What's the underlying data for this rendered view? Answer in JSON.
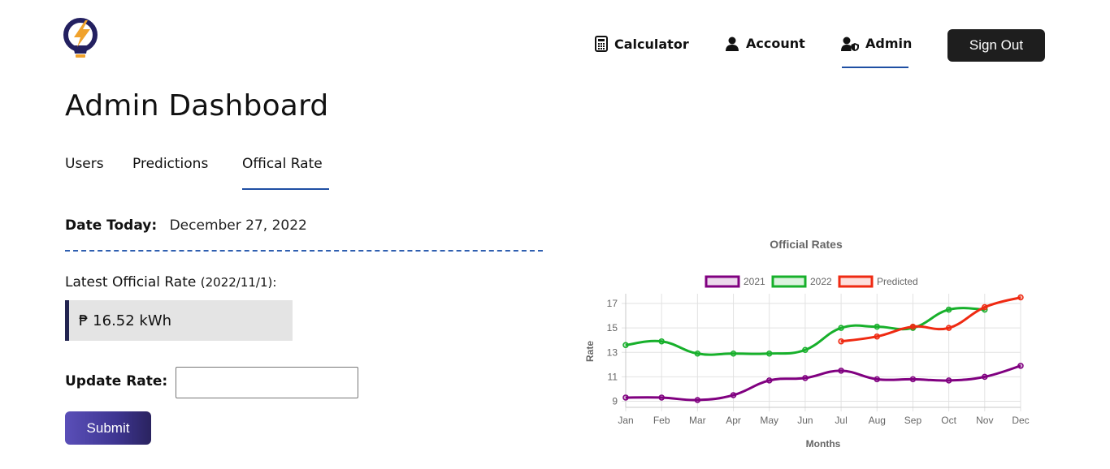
{
  "brand": {
    "logo_icon": "lightbulb-bolt-icon",
    "colors": {
      "bulb": "#232060",
      "bolt": "#f0a22c"
    }
  },
  "nav": {
    "items": [
      {
        "label": "Calculator",
        "icon": "calculator-icon"
      },
      {
        "label": "Account",
        "icon": "user-icon"
      },
      {
        "label": "Admin",
        "icon": "user-shield-icon",
        "active": true
      }
    ],
    "signout_label": "Sign Out"
  },
  "page": {
    "title": "Admin Dashboard"
  },
  "tabs": [
    {
      "label": "Users"
    },
    {
      "label": "Predictions"
    },
    {
      "label": "Offical Rate",
      "active": true
    }
  ],
  "rate_panel": {
    "date_label": "Date Today:",
    "date_value": "December 27, 2022",
    "latest_label": "Latest Official Rate",
    "latest_date": "(2022/11/1):",
    "latest_value": "₱ 16.52 kWh",
    "update_label": "Update Rate:",
    "update_value": "",
    "submit_label": "Submit"
  },
  "colors": {
    "accent": "#1f4fa3",
    "dark_button": "#1e1e1e",
    "submit_start": "#5a4fb8",
    "submit_end": "#2a235f",
    "rate_box_bg": "#e4e4e4"
  },
  "chart_data": {
    "type": "line",
    "title": "Official Rates",
    "xlabel": "Months",
    "ylabel": "Rate",
    "categories": [
      "Jan",
      "Feb",
      "Mar",
      "Apr",
      "May",
      "Jun",
      "Jul",
      "Aug",
      "Sep",
      "Oct",
      "Nov",
      "Dec"
    ],
    "yticks": [
      9,
      11,
      13,
      15,
      17
    ],
    "ylim": [
      8.5,
      17.8
    ],
    "grid": true,
    "legend_position": "top",
    "series": [
      {
        "name": "2021",
        "color": "#800080",
        "values": [
          9.3,
          9.3,
          9.1,
          9.5,
          10.7,
          10.9,
          11.5,
          10.8,
          10.8,
          10.7,
          11.0,
          11.9
        ]
      },
      {
        "name": "2022",
        "color": "#17b02b",
        "values": [
          13.6,
          13.9,
          12.9,
          12.9,
          12.9,
          13.2,
          15.0,
          15.1,
          15.0,
          16.5,
          16.5,
          null
        ]
      },
      {
        "name": "Predicted",
        "color": "#ef2a12",
        "values": [
          null,
          null,
          null,
          null,
          null,
          null,
          13.9,
          14.3,
          15.1,
          15.0,
          16.7,
          17.5
        ]
      }
    ]
  }
}
